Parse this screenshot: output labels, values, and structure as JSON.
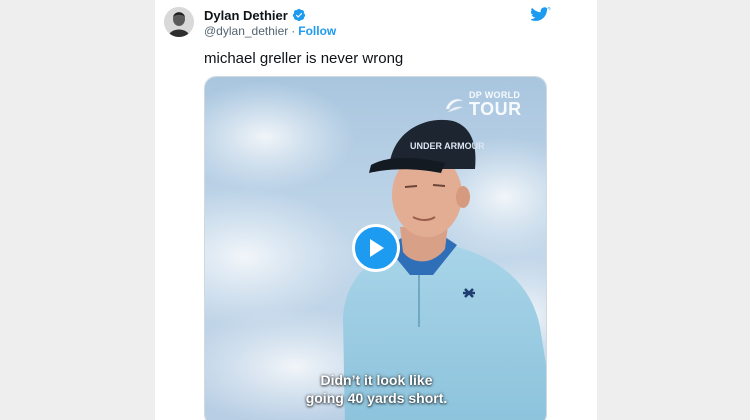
{
  "tweet": {
    "author": {
      "display_name": "Dylan Dethier",
      "handle": "@dylan_dethier",
      "separator": "·",
      "follow_label": "Follow",
      "avatar_icon": "avatar-photo",
      "verified_icon": "verified-badge-icon"
    },
    "platform_icon": "twitter-bird-icon",
    "text": "michael greller is never wrong",
    "media": {
      "watermark_line1": "DP WORLD",
      "watermark_line2": "TOUR",
      "cap_text": "UNDER ARMOUR",
      "play_icon": "play-icon",
      "caption_line1": "Didn’t it look like",
      "caption_line2": "going 40 yards short."
    }
  },
  "colors": {
    "accent": "#1d9bf0",
    "text_primary": "#0f1419",
    "text_secondary": "#536471",
    "page_background": "#eeeeee"
  }
}
